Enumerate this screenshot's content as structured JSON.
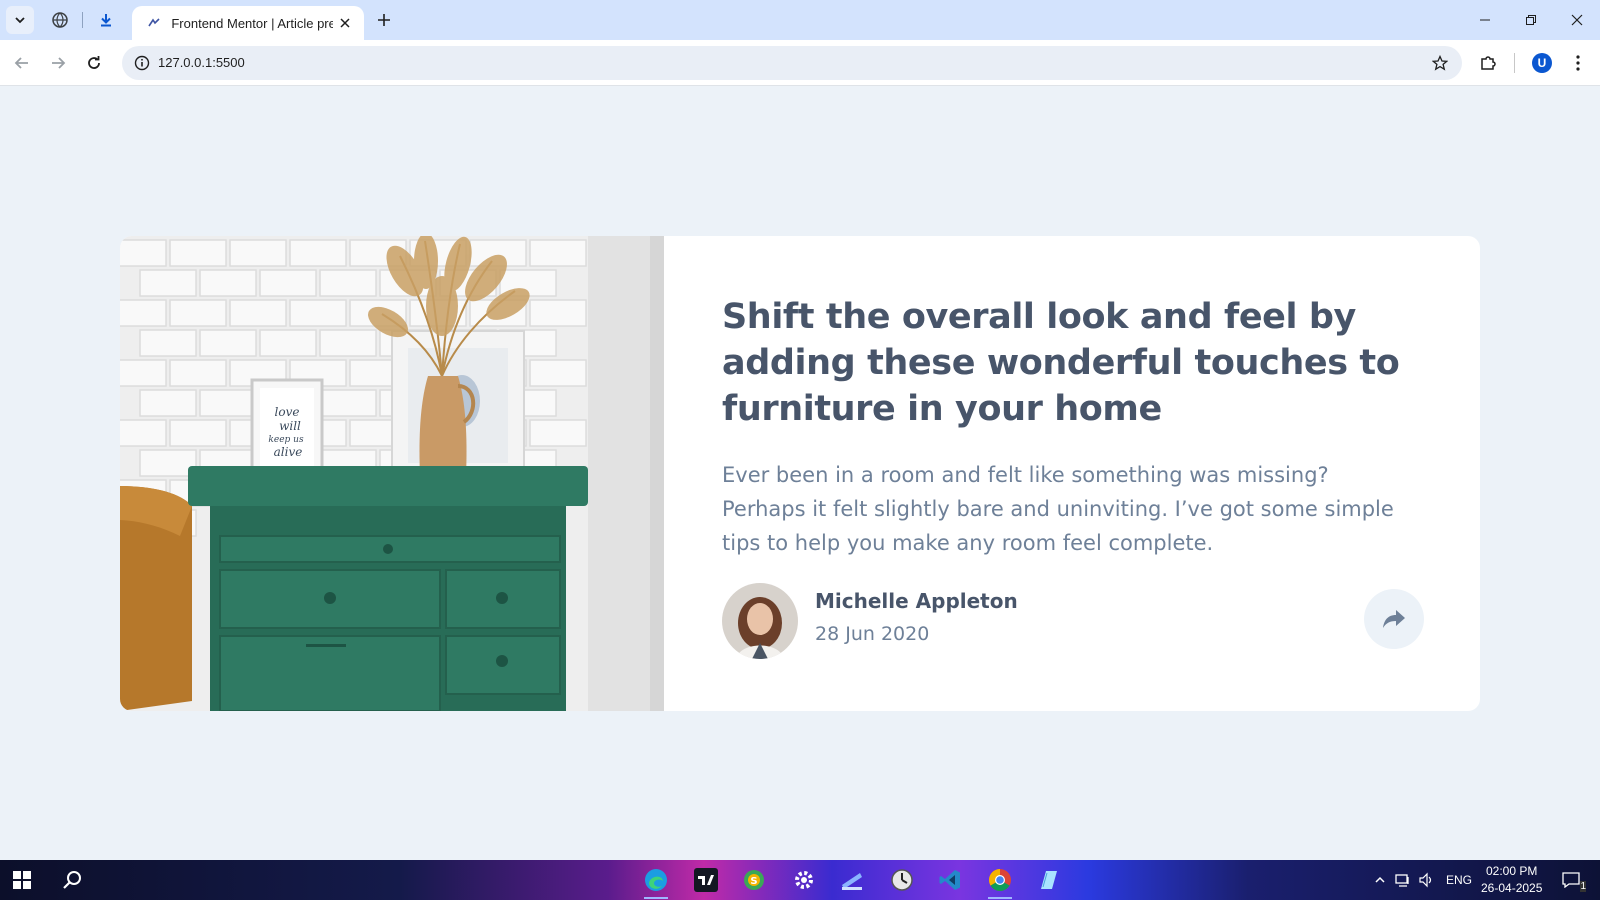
{
  "browser": {
    "tab": {
      "title": "Frontend Mentor | Article preview component"
    },
    "omnibox": {
      "url": "127.0.0.1:5500"
    },
    "profile_initial": "U"
  },
  "article": {
    "title": "Shift the overall look and feel by adding these wonderful touches to furniture in your home",
    "excerpt": "Ever been in a room and felt like something was missing? Perhaps it felt slightly bare and uninviting. I’ve got some simple tips to help you make any room feel complete.",
    "author": {
      "name": "Michelle Appleton",
      "date": "28 Jun 2020"
    },
    "image_frame_text": [
      "love",
      "will",
      "keep us",
      "alive"
    ]
  },
  "taskbar": {
    "apps": [
      "edge",
      "tradingview",
      "app-s",
      "settings",
      "files",
      "clock",
      "vscode",
      "chrome",
      "notes"
    ],
    "tray": {
      "language": "ENG",
      "time": "02:00 PM",
      "date": "26-04-2025",
      "notification_count": "1"
    }
  },
  "colors": {
    "page_bg": "#ecf2f8",
    "heading": "#48556a",
    "body_text": "#6e8098",
    "drawer_green": "#2e7a62"
  }
}
